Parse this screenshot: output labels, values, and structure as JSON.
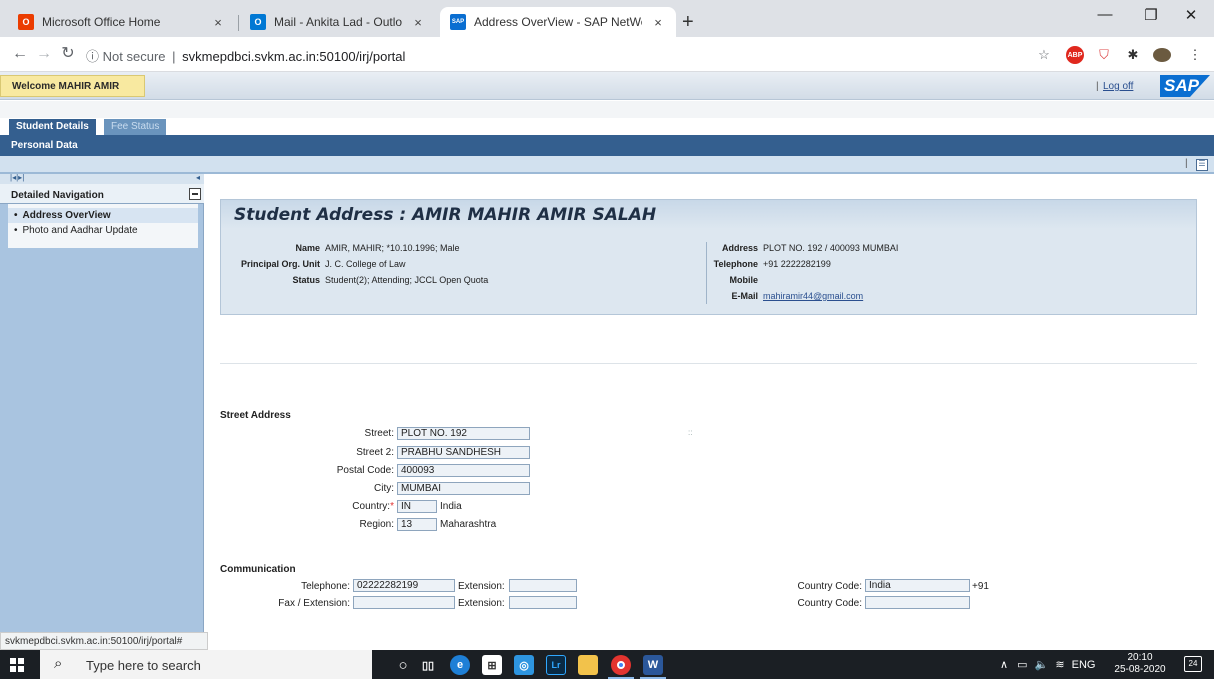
{
  "browser": {
    "tabs": [
      {
        "title": "Microsoft Office Home",
        "icon": "office-icon",
        "color": "#eb3c00"
      },
      {
        "title": "Mail - Ankita Lad - Outlook",
        "icon": "outlook-icon",
        "color": "#0078d4"
      },
      {
        "title": "Address OverView - SAP NetWea",
        "icon": "sap-icon",
        "color": "#0a6ed1"
      }
    ],
    "tab_close": "×",
    "new_tab": "+",
    "window_controls": {
      "minimize": "—",
      "maximize": "❐",
      "close": "✕"
    },
    "address_bar": {
      "security_label": "Not secure",
      "separator": "|",
      "url": "svkmepdbci.svkm.ac.in:50100/irj/portal"
    }
  },
  "portal": {
    "welcome": "Welcome MAHIR AMIR",
    "logoff_separator": "|",
    "logoff": "Log off",
    "logo_text": "SAP",
    "tabs": {
      "active": "Student Details",
      "inactive": "Fee Status"
    },
    "subtab": "Personal Data",
    "page_menu_separator": "|"
  },
  "nav": {
    "title": "Detailed Navigation",
    "items": [
      {
        "label": "Address OverView",
        "selected": true
      },
      {
        "label": "Photo and Aadhar Update",
        "selected": false
      }
    ]
  },
  "student": {
    "title": "Student Address : AMIR MAHIR AMIR SALAH",
    "left": [
      {
        "label": "Name",
        "value": "AMIR, MAHIR; *10.10.1996; Male"
      },
      {
        "label": "Principal Org. Unit",
        "value": "J. C. College of Law"
      },
      {
        "label": "Status",
        "value": "Student(2); Attending; JCCL Open Quota"
      }
    ],
    "right": [
      {
        "label": "Address",
        "value": "PLOT NO. 192 / 400093 MUMBAI"
      },
      {
        "label": "Telephone",
        "value": "+91 2222282199"
      },
      {
        "label": "Mobile",
        "value": ""
      },
      {
        "label": "E-Mail",
        "value": "mahiramir44@gmail.com"
      }
    ]
  },
  "street": {
    "title": "Street Address",
    "street_label": "Street:",
    "street": "PLOT NO. 192",
    "street2_label": "Street 2:",
    "street2": "PRABHU SANDHESH",
    "postal_label": "Postal Code:",
    "postal": "400093",
    "city_label": "City:",
    "city": "MUMBAI",
    "country_label": "Country:",
    "required_mark": "*",
    "country_code": "IN",
    "country_name": "India",
    "region_label": "Region:",
    "region_code": "13",
    "region_name": "Maharashtra",
    "dots": "::"
  },
  "communication": {
    "title": "Communication",
    "telephone_label": "Telephone:",
    "telephone": "02222282199",
    "extension_label": "Extension:",
    "extension": "",
    "country_code_label": "Country Code:",
    "country_code": "India",
    "dial_code": "+91",
    "fax_label": "Fax / Extension:",
    "fax": "",
    "fax_extension_label": "Extension:",
    "fax_extension": "",
    "fax_country_code_label": "Country Code:",
    "fax_country_code": ""
  },
  "status_bar": "svkmepdbci.svkm.ac.in:50100/irj/portal#",
  "taskbar": {
    "search_placeholder": "Type here to search",
    "tray_lang": "ENG",
    "time": "20:10",
    "date": "25-08-2020",
    "notifications": "24"
  }
}
